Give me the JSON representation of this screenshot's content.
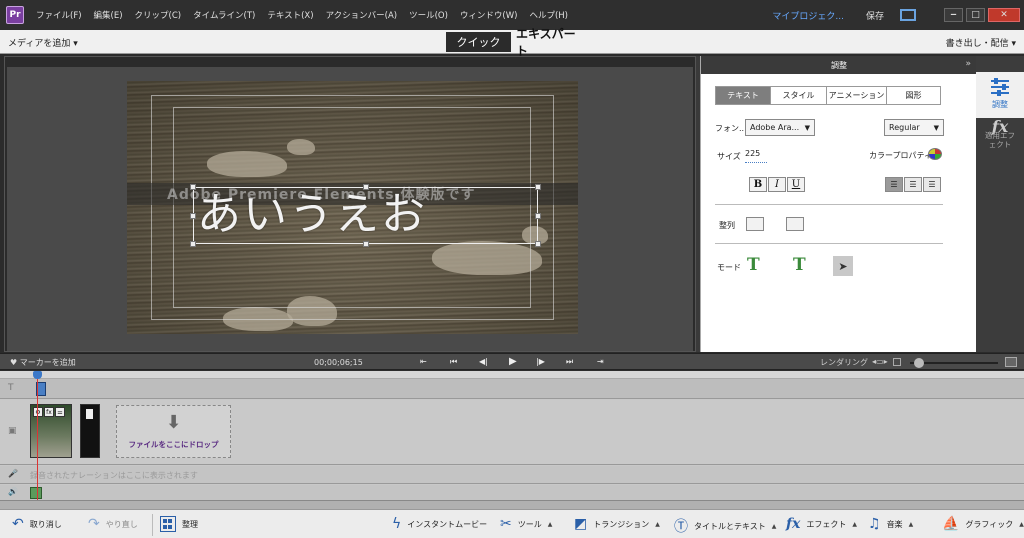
{
  "menubar": {
    "app_icon_label": "Pr",
    "items": [
      "ファイル(F)",
      "編集(E)",
      "クリップ(C)",
      "タイムライン(T)",
      "テキスト(X)",
      "アクションバー(A)",
      "ツール(O)",
      "ウィンドウ(W)",
      "ヘルプ(H)"
    ],
    "project": "マイプロジェク...",
    "save": "保存",
    "window_buttons": [
      "‒",
      "□",
      "✕"
    ]
  },
  "modebar": {
    "add_media": "メディアを追加 ▾",
    "quick": "クイック",
    "expert": "エキスパート",
    "export_share": "書き出し・配信 ▾"
  },
  "monitor": {
    "ghost_text": "Adobe Premiere Elements 体験版です",
    "title_text": "あいうえお"
  },
  "adjust_panel": {
    "header": "調整",
    "collapse": "»",
    "tabs": [
      "テキスト",
      "スタイル",
      "アニメーション",
      "図形"
    ],
    "active_tab": "テキスト",
    "font_label": "フォン...",
    "font_value": "Adobe Ara...",
    "font_style": "Regular",
    "size_label": "サイズ",
    "size_value": "225",
    "color_label": "カラープロパティ :",
    "format_buttons": [
      "B",
      "I",
      "U"
    ],
    "align_label": "整列",
    "mode_label": "モード",
    "mode_select_glyph": "➤"
  },
  "right_rail": {
    "adjust_label": "調整",
    "fx_glyph": "fx",
    "effect_label": "適用エフェクト"
  },
  "transport": {
    "add_marker": "♥ マーカーを追加",
    "timecode": "00;00;06;15",
    "buttons": [
      "⇤",
      "⏮",
      "◀|",
      "▶",
      "|▶",
      "⏭",
      "⇥"
    ],
    "render": "レンダリング",
    "zoom_icon": "◂▭▸"
  },
  "timeline": {
    "title_track_icon": "T",
    "video_track_icon": "▣",
    "narration_icon": "🎤",
    "audio_icon": "🔊",
    "clip_fx": [
      "⚙",
      "fx",
      "⚌"
    ],
    "drop_arrow": "⬇",
    "drop_text": "ファイルをここにドロップ",
    "narration_text": "録音されたナレーションはここに表示されます"
  },
  "actionbar": {
    "undo": "取り消し",
    "redo": "やり直し",
    "organize": "整理",
    "instant_movie": "インスタントムービー",
    "tools": "ツール",
    "transitions": "トランジション",
    "titles_text": "タイトルとテキスト",
    "effects": "エフェクト",
    "music": "音楽",
    "graphics": "グラフィック",
    "caret": "▲"
  }
}
